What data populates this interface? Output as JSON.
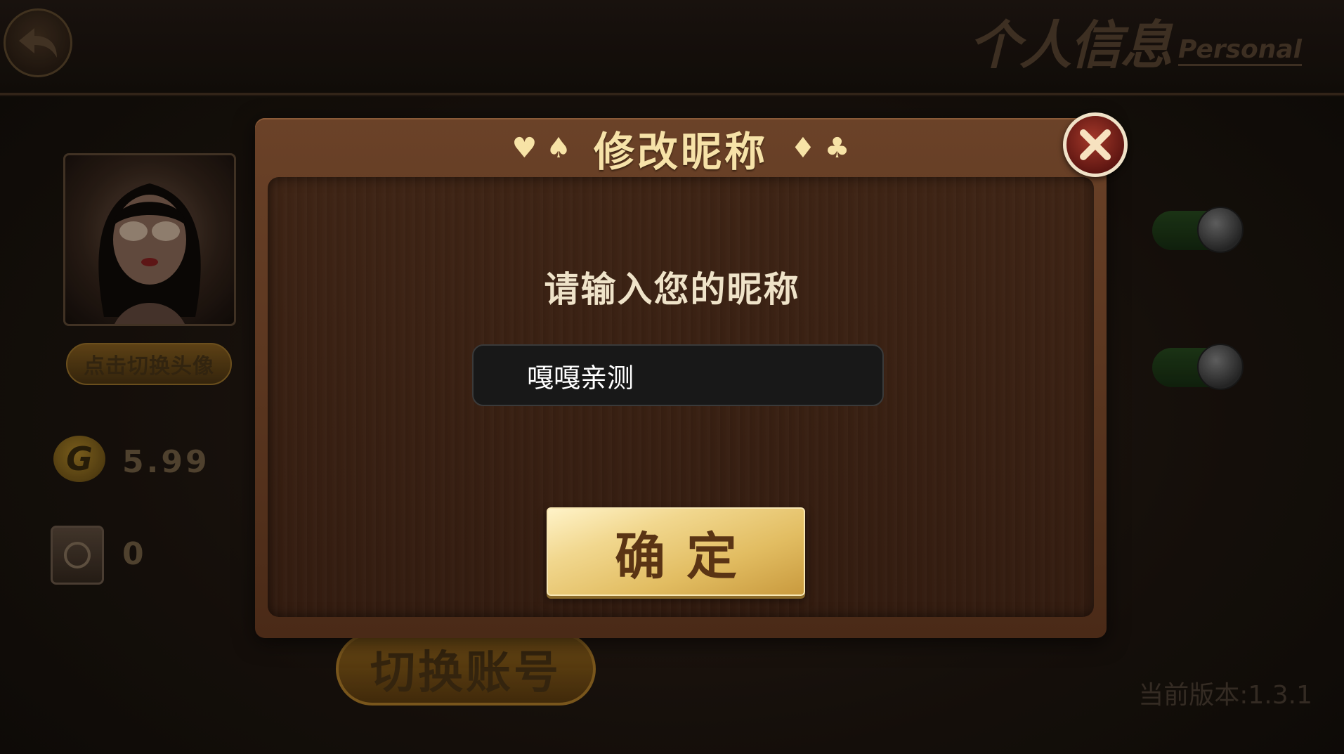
{
  "header": {
    "title_cn": "个人信息",
    "title_en": "Personal",
    "back_icon": "back-arrow-icon"
  },
  "profile": {
    "change_avatar_label": "点击切换头像",
    "gold_value": "5.99",
    "safe_value": "0"
  },
  "settings": {
    "toggle_1": true,
    "toggle_2": true
  },
  "footer": {
    "switch_account_label": "切换账号",
    "version_text": "当前版本:1.3.1"
  },
  "dialog": {
    "title": "修改昵称",
    "suits_left": "♥ ♠",
    "suits_right": "♦ ♣",
    "prompt": "请输入您的昵称",
    "input_value": "嘎嘎亲测",
    "confirm_label": "确定"
  },
  "colors": {
    "accent_gold": "#e2bd62",
    "dialog_wood": "#4a2a17",
    "close_red": "#a4382a"
  }
}
